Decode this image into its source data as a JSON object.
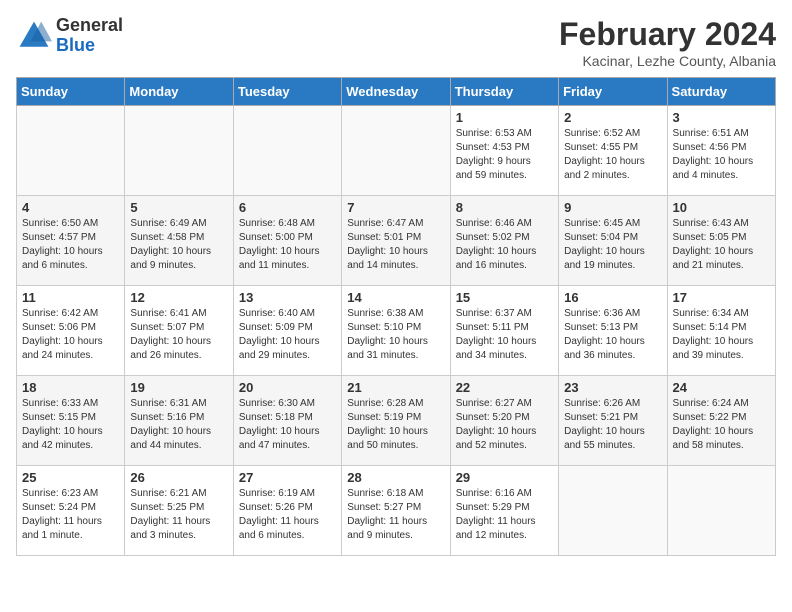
{
  "logo": {
    "general": "General",
    "blue": "Blue"
  },
  "title": "February 2024",
  "subtitle": "Kacinar, Lezhe County, Albania",
  "days_of_week": [
    "Sunday",
    "Monday",
    "Tuesday",
    "Wednesday",
    "Thursday",
    "Friday",
    "Saturday"
  ],
  "weeks": [
    [
      {
        "day": "",
        "info": ""
      },
      {
        "day": "",
        "info": ""
      },
      {
        "day": "",
        "info": ""
      },
      {
        "day": "",
        "info": ""
      },
      {
        "day": "1",
        "info": "Sunrise: 6:53 AM\nSunset: 4:53 PM\nDaylight: 9 hours\nand 59 minutes."
      },
      {
        "day": "2",
        "info": "Sunrise: 6:52 AM\nSunset: 4:55 PM\nDaylight: 10 hours\nand 2 minutes."
      },
      {
        "day": "3",
        "info": "Sunrise: 6:51 AM\nSunset: 4:56 PM\nDaylight: 10 hours\nand 4 minutes."
      }
    ],
    [
      {
        "day": "4",
        "info": "Sunrise: 6:50 AM\nSunset: 4:57 PM\nDaylight: 10 hours\nand 6 minutes."
      },
      {
        "day": "5",
        "info": "Sunrise: 6:49 AM\nSunset: 4:58 PM\nDaylight: 10 hours\nand 9 minutes."
      },
      {
        "day": "6",
        "info": "Sunrise: 6:48 AM\nSunset: 5:00 PM\nDaylight: 10 hours\nand 11 minutes."
      },
      {
        "day": "7",
        "info": "Sunrise: 6:47 AM\nSunset: 5:01 PM\nDaylight: 10 hours\nand 14 minutes."
      },
      {
        "day": "8",
        "info": "Sunrise: 6:46 AM\nSunset: 5:02 PM\nDaylight: 10 hours\nand 16 minutes."
      },
      {
        "day": "9",
        "info": "Sunrise: 6:45 AM\nSunset: 5:04 PM\nDaylight: 10 hours\nand 19 minutes."
      },
      {
        "day": "10",
        "info": "Sunrise: 6:43 AM\nSunset: 5:05 PM\nDaylight: 10 hours\nand 21 minutes."
      }
    ],
    [
      {
        "day": "11",
        "info": "Sunrise: 6:42 AM\nSunset: 5:06 PM\nDaylight: 10 hours\nand 24 minutes."
      },
      {
        "day": "12",
        "info": "Sunrise: 6:41 AM\nSunset: 5:07 PM\nDaylight: 10 hours\nand 26 minutes."
      },
      {
        "day": "13",
        "info": "Sunrise: 6:40 AM\nSunset: 5:09 PM\nDaylight: 10 hours\nand 29 minutes."
      },
      {
        "day": "14",
        "info": "Sunrise: 6:38 AM\nSunset: 5:10 PM\nDaylight: 10 hours\nand 31 minutes."
      },
      {
        "day": "15",
        "info": "Sunrise: 6:37 AM\nSunset: 5:11 PM\nDaylight: 10 hours\nand 34 minutes."
      },
      {
        "day": "16",
        "info": "Sunrise: 6:36 AM\nSunset: 5:13 PM\nDaylight: 10 hours\nand 36 minutes."
      },
      {
        "day": "17",
        "info": "Sunrise: 6:34 AM\nSunset: 5:14 PM\nDaylight: 10 hours\nand 39 minutes."
      }
    ],
    [
      {
        "day": "18",
        "info": "Sunrise: 6:33 AM\nSunset: 5:15 PM\nDaylight: 10 hours\nand 42 minutes."
      },
      {
        "day": "19",
        "info": "Sunrise: 6:31 AM\nSunset: 5:16 PM\nDaylight: 10 hours\nand 44 minutes."
      },
      {
        "day": "20",
        "info": "Sunrise: 6:30 AM\nSunset: 5:18 PM\nDaylight: 10 hours\nand 47 minutes."
      },
      {
        "day": "21",
        "info": "Sunrise: 6:28 AM\nSunset: 5:19 PM\nDaylight: 10 hours\nand 50 minutes."
      },
      {
        "day": "22",
        "info": "Sunrise: 6:27 AM\nSunset: 5:20 PM\nDaylight: 10 hours\nand 52 minutes."
      },
      {
        "day": "23",
        "info": "Sunrise: 6:26 AM\nSunset: 5:21 PM\nDaylight: 10 hours\nand 55 minutes."
      },
      {
        "day": "24",
        "info": "Sunrise: 6:24 AM\nSunset: 5:22 PM\nDaylight: 10 hours\nand 58 minutes."
      }
    ],
    [
      {
        "day": "25",
        "info": "Sunrise: 6:23 AM\nSunset: 5:24 PM\nDaylight: 11 hours\nand 1 minute."
      },
      {
        "day": "26",
        "info": "Sunrise: 6:21 AM\nSunset: 5:25 PM\nDaylight: 11 hours\nand 3 minutes."
      },
      {
        "day": "27",
        "info": "Sunrise: 6:19 AM\nSunset: 5:26 PM\nDaylight: 11 hours\nand 6 minutes."
      },
      {
        "day": "28",
        "info": "Sunrise: 6:18 AM\nSunset: 5:27 PM\nDaylight: 11 hours\nand 9 minutes."
      },
      {
        "day": "29",
        "info": "Sunrise: 6:16 AM\nSunset: 5:29 PM\nDaylight: 11 hours\nand 12 minutes."
      },
      {
        "day": "",
        "info": ""
      },
      {
        "day": "",
        "info": ""
      }
    ]
  ]
}
